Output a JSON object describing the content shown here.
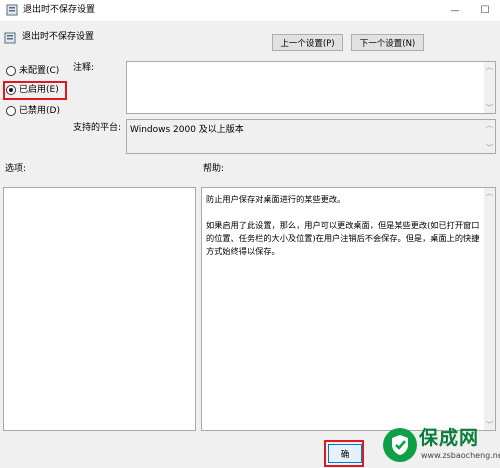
{
  "window": {
    "title": "退出时不保存设置",
    "icon": "policy-settings-icon",
    "controls": {
      "minimize": "—",
      "maximize": "☐"
    }
  },
  "header": {
    "icon": "policy-settings-icon",
    "setting_name": "退出时不保存设置",
    "prev_button": "上一个设置(P)",
    "next_button": "下一个设置(N)"
  },
  "state": {
    "options": [
      {
        "label": "未配置(C)",
        "checked": false
      },
      {
        "label": "已启用(E)",
        "checked": true
      },
      {
        "label": "已禁用(D)",
        "checked": false
      }
    ]
  },
  "comment": {
    "label": "注释:",
    "value": ""
  },
  "platform": {
    "label": "支持的平台:",
    "value": "Windows 2000 及以上版本"
  },
  "options_panel": {
    "label": "选项:"
  },
  "help_panel": {
    "label": "帮助:",
    "paragraphs": [
      "防止用户保存对桌面进行的某些更改。",
      "如果启用了此设置，那么，用户可以更改桌面，但是某些更改(如已打开窗口的位置、任务栏的大小及位置)在用户注销后不会保存。但是，桌面上的快捷方式始终得以保存。"
    ]
  },
  "footer": {
    "ok_button": "确"
  },
  "watermark": {
    "title": "保成网",
    "url": "www.zsbaocheng.net"
  },
  "colors": {
    "highlight": "#e0191f",
    "dialog_bg": "#f0f0f0",
    "watermark_green": "#0ea047"
  }
}
